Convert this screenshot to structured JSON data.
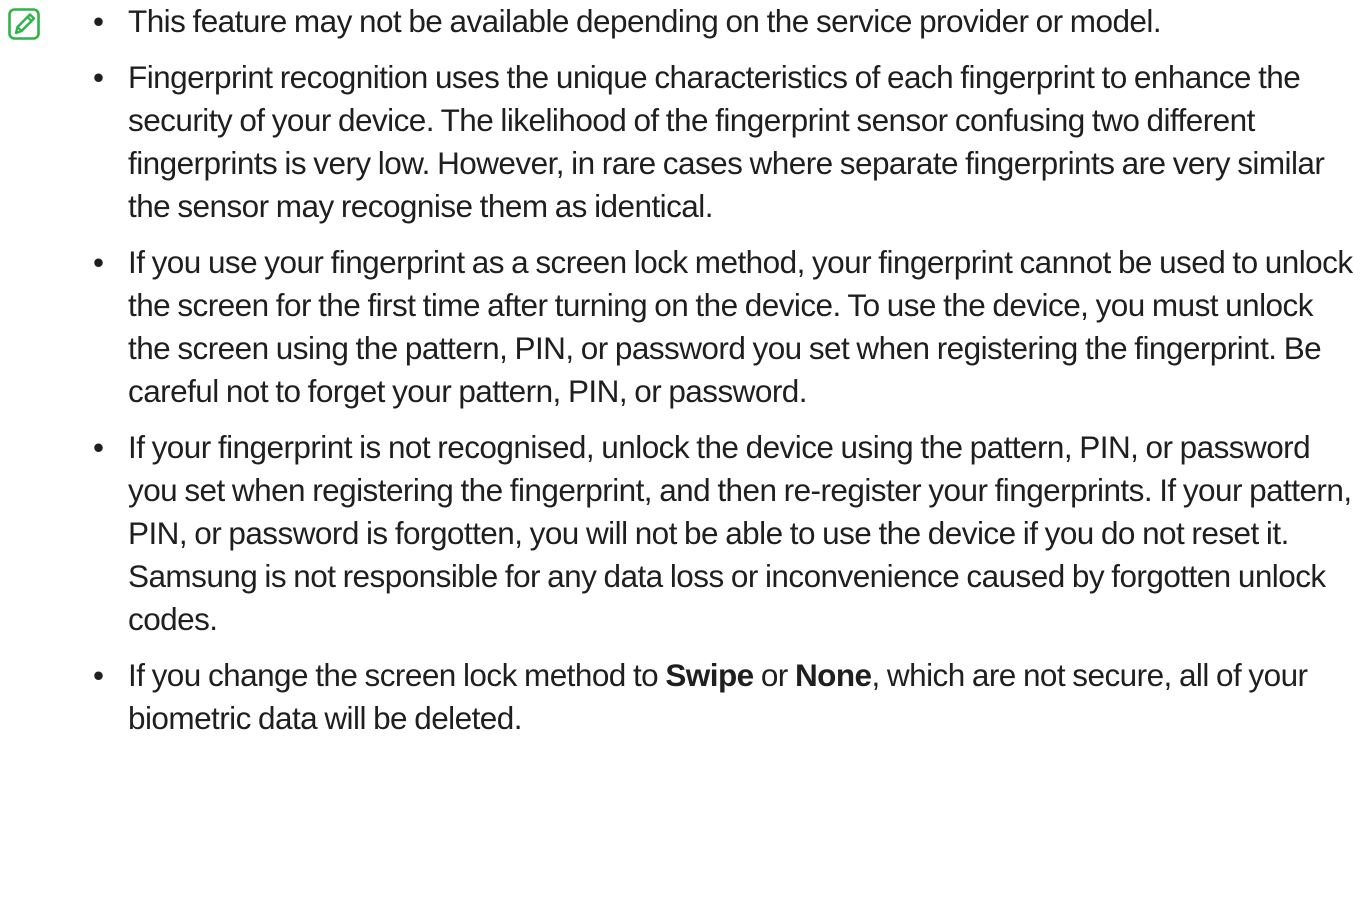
{
  "note": {
    "icon": "note-pencil-icon",
    "accent_color": "#2fb34a",
    "items": [
      {
        "text": "This feature may not be available depending on the service provider or model."
      },
      {
        "text": "Fingerprint recognition uses the unique characteristics of each fingerprint to enhance the security of your device. The likelihood of the fingerprint sensor confusing two different fingerprints is very low. However, in rare cases where separate fingerprints are very similar the sensor may recognise them as identical."
      },
      {
        "text": "If you use your fingerprint as a screen lock method, your fingerprint cannot be used to unlock the screen for the first time after turning on the device. To use the device, you must unlock the screen using the pattern, PIN, or password you set when registering the fingerprint. Be careful not to forget your pattern, PIN, or password."
      },
      {
        "text": "If your fingerprint is not recognised, unlock the device using the pattern, PIN, or password you set when registering the fingerprint, and then re-register your fingerprints. If your pattern, PIN, or password is forgotten, you will not be able to use the device if you do not reset it. Samsung is not responsible for any data loss or inconvenience caused by forgotten unlock codes."
      },
      {
        "text_before": "If you change the screen lock method to ",
        "bold_1": "Swipe",
        "text_middle": " or ",
        "bold_2": "None",
        "text_after": ", which are not secure, all of your biometric data will be deleted."
      }
    ]
  }
}
